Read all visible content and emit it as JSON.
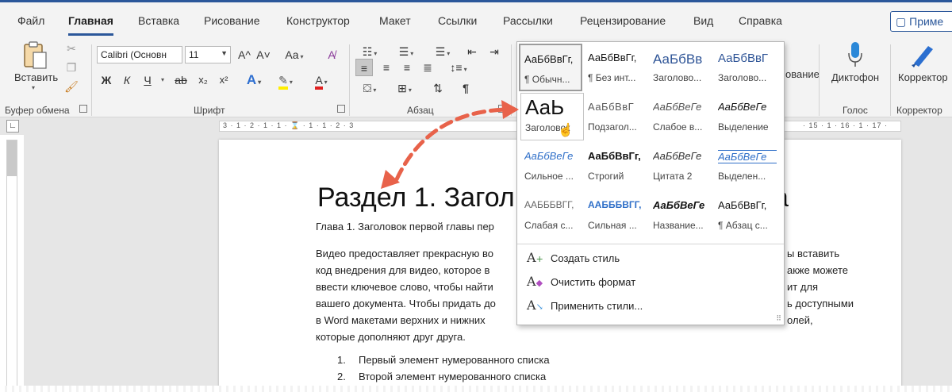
{
  "tabs": [
    {
      "label": "Файл",
      "active": false
    },
    {
      "label": "Главная",
      "active": true
    },
    {
      "label": "Вставка",
      "active": false
    },
    {
      "label": "Рисование",
      "active": false
    },
    {
      "label": "Конструктор",
      "active": false
    },
    {
      "label": "Макет",
      "active": false
    },
    {
      "label": "Ссылки",
      "active": false
    },
    {
      "label": "Рассылки",
      "active": false
    },
    {
      "label": "Рецензирование",
      "active": false
    },
    {
      "label": "Вид",
      "active": false
    },
    {
      "label": "Справка",
      "active": false
    }
  ],
  "notes_button": "Приме",
  "clipboard": {
    "paste_label": "Вставить",
    "group_label": "Буфер обмена"
  },
  "font": {
    "name": "Calibri (Основн",
    "size": "11",
    "group_label": "Шрифт",
    "bold": "Ж",
    "italic": "К",
    "underline": "Ч",
    "strike": "ab",
    "subscript": "x₂",
    "superscript": "x²",
    "grow": "A^",
    "shrink": "A˅",
    "case": "Aa",
    "text_effects": "A",
    "font_color": "A"
  },
  "paragraph": {
    "group_label": "Абзац"
  },
  "styles": {
    "partial_label": "ование"
  },
  "voice": {
    "dictate_label": "Диктофон",
    "group_label": "Голос"
  },
  "editor": {
    "label": "Корректор",
    "group_label": "Корректор"
  },
  "ruler": {
    "marks": "3 · 1 · 2 · 1 · 1 · ⌛ · 1 · 1 · 2 · 3",
    "right_marks": "· 15 · 1 · 16 · 1 · 17 ·"
  },
  "gallery": {
    "styles": [
      {
        "sample": "АаБбВвГг,",
        "name": "¶ Обычн...",
        "style": "normal"
      },
      {
        "sample": "АаБбВвГг,",
        "name": "¶ Без инт...",
        "style": "nospace"
      },
      {
        "sample": "АаБбВв",
        "name": "Заголово...",
        "style": "h1"
      },
      {
        "sample": "АаБбВвГ",
        "name": "Заголово...",
        "style": "h2"
      },
      {
        "sample": "АаЬ",
        "name": "Заголовок",
        "style": "title"
      },
      {
        "sample": "АаБбВвГ",
        "name": "Подзагол...",
        "style": "subtitle"
      },
      {
        "sample": "АаБбВеГе",
        "name": "Слабое в...",
        "style": "subtle"
      },
      {
        "sample": "АаБбВеГе",
        "name": "Выделение",
        "style": "emphasis"
      },
      {
        "sample": "АаБбВеГе",
        "name": "Сильное ...",
        "style": "intense"
      },
      {
        "sample": "АаБбВвГг,",
        "name": "Строгий",
        "style": "strong"
      },
      {
        "sample": "АаБбВеГе",
        "name": "Цитата 2",
        "style": "quote"
      },
      {
        "sample": "АаБбВеГе",
        "name": "Выделен...",
        "style": "intensequote"
      },
      {
        "sample": "ААБББВГГ,",
        "name": "Слабая с...",
        "style": "subtleref"
      },
      {
        "sample": "ААБББВГГ,",
        "name": "Сильная ...",
        "style": "intenseref"
      },
      {
        "sample": "АаБбВеГе",
        "name": "Название...",
        "style": "booktitle"
      },
      {
        "sample": "АаБбВвГг,",
        "name": "¶ Абзац с...",
        "style": "listpara"
      }
    ],
    "commands": [
      {
        "glyph": "A₊",
        "label": "Создать стиль"
      },
      {
        "glyph": "A̷",
        "label": "Очистить формат"
      },
      {
        "glyph": "A↘",
        "label": "Применить стили..."
      }
    ]
  },
  "document": {
    "heading": "Раздел 1. Загол",
    "heading_tail": "а",
    "subheading": "Глава 1. Заголовок первой главы пер",
    "paragraph_lines": [
      {
        "left": "Видео предоставляет прекрасную во",
        "right": "ы вставить"
      },
      {
        "left": "код внедрения для видео, которое в",
        "right": "акже можете"
      },
      {
        "left": "ввести ключевое слово, чтобы найти",
        "right": "ит для"
      },
      {
        "left": "вашего документа. Чтобы придать до",
        "right": "ь доступными"
      },
      {
        "left": "в Word макетами верхних и нижних",
        "right": "олей,"
      },
      {
        "left": "которые дополняют друг друга.",
        "right": ""
      }
    ],
    "list": [
      {
        "num": "1.",
        "text": "Первый элемент нумерованного списка"
      },
      {
        "num": "2.",
        "text": "Второй элемент нумерованного списка"
      }
    ]
  },
  "colors": {
    "accent": "#2b579a",
    "arrow": "#e8624a"
  }
}
